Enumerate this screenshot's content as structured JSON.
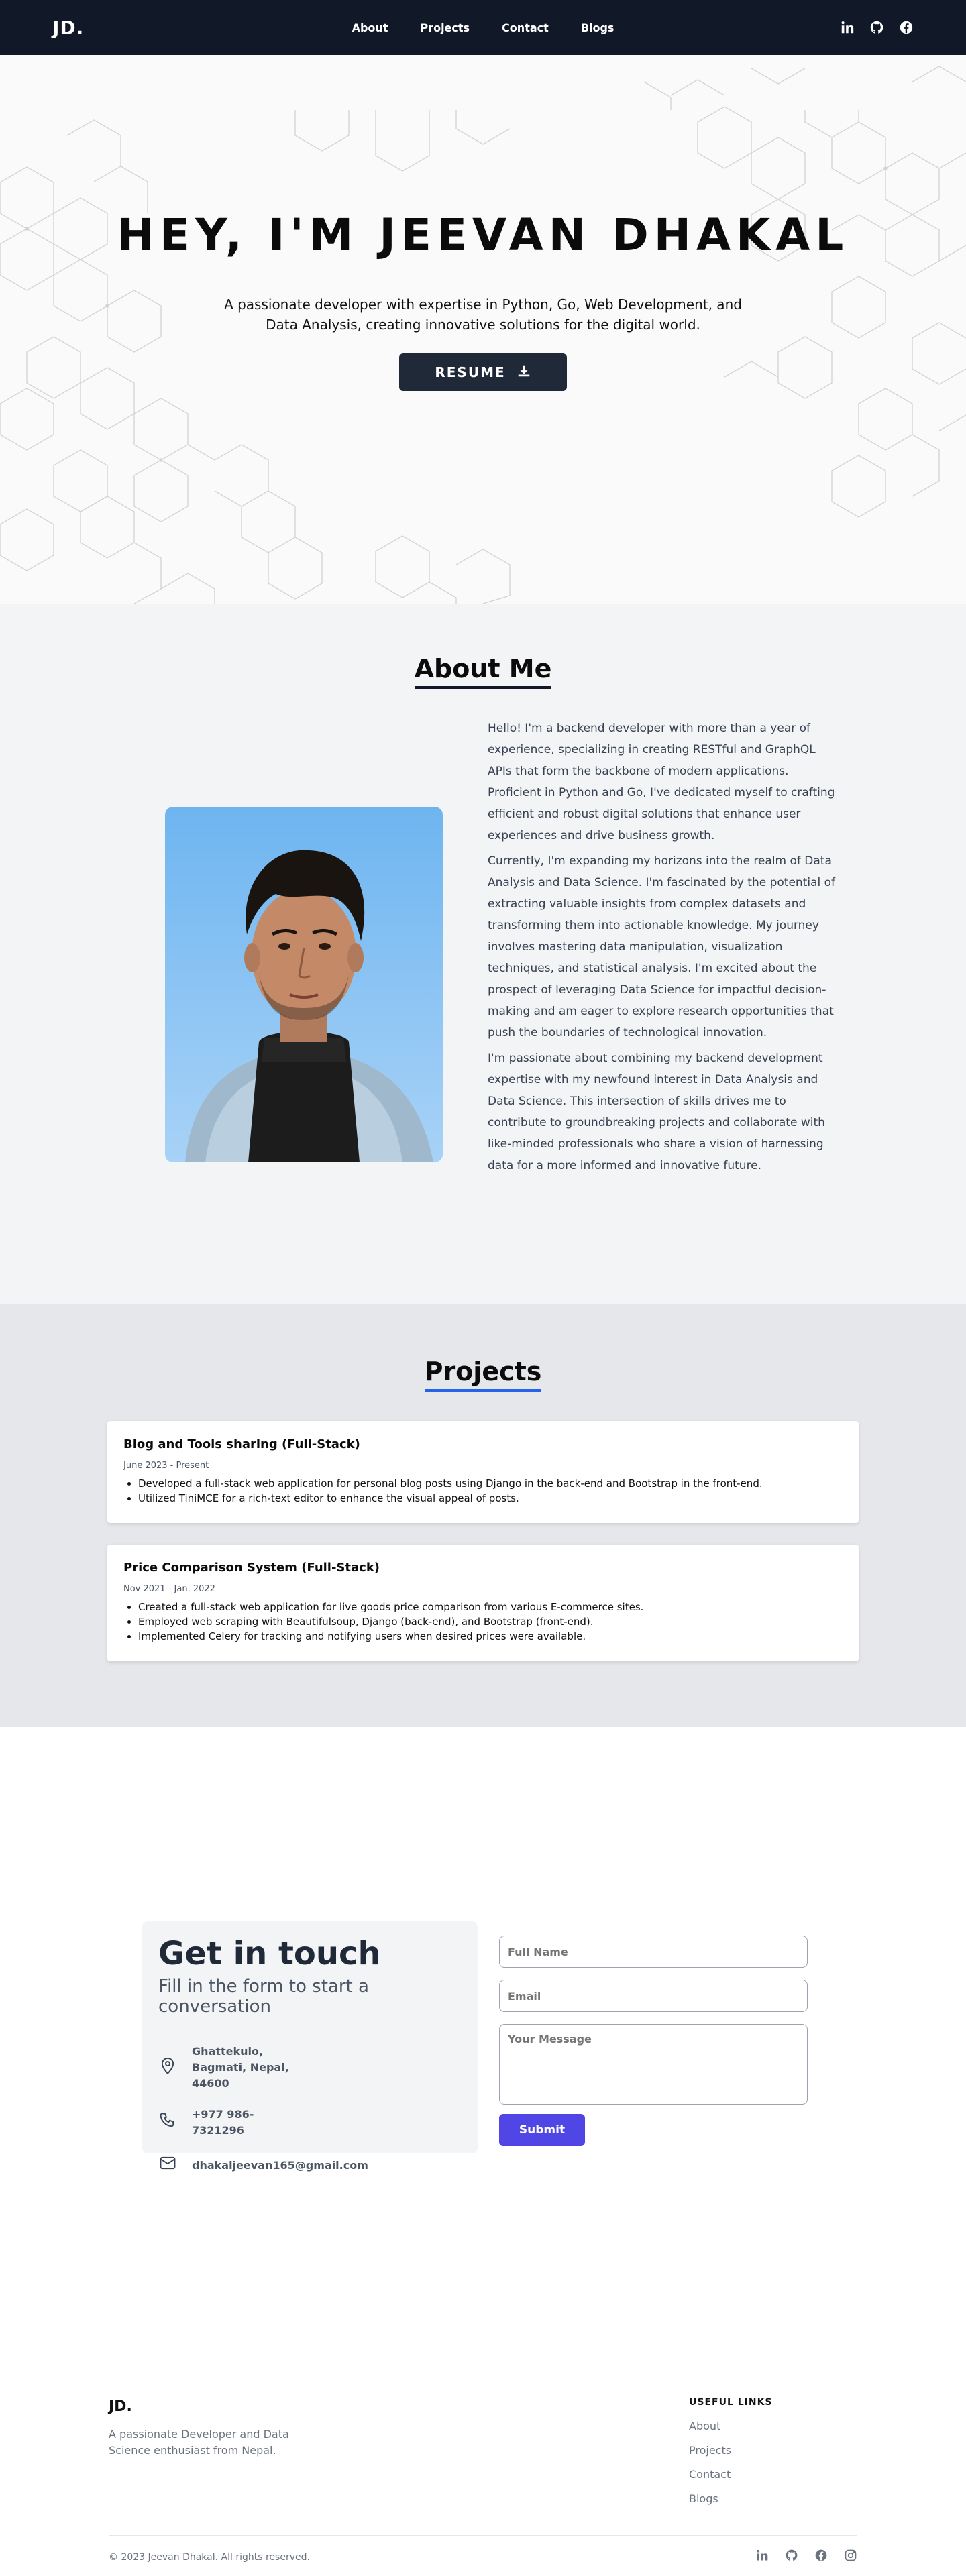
{
  "nav": {
    "logo": "JD.",
    "links": [
      "About",
      "Projects",
      "Contact",
      "Blogs"
    ],
    "icons": [
      "linkedin-icon",
      "github-icon",
      "facebook-icon"
    ]
  },
  "hero": {
    "title": "HEY, I'M JEEVAN DHAKAL",
    "subtitle": "A passionate developer with expertise in Python, Go, Web Development, and Data Analysis, creating innovative solutions for the digital world.",
    "resume_label": "RESUME"
  },
  "about": {
    "title": "About Me",
    "paragraphs": [
      "Hello! I'm a backend developer with more than a year of experience, specializing in creating RESTful and GraphQL APIs that form the backbone of modern applications. Proficient in Python and Go, I've dedicated myself to crafting efficient and robust digital solutions that enhance user experiences and drive business growth.",
      "Currently, I'm expanding my horizons into the realm of Data Analysis and Data Science. I'm fascinated by the potential of extracting valuable insights from complex datasets and transforming them into actionable knowledge. My journey involves mastering data manipulation, visualization techniques, and statistical analysis. I'm excited about the prospect of leveraging Data Science for impactful decision-making and am eager to explore research opportunities that push the boundaries of technological innovation.",
      "I'm passionate about combining my backend development expertise with my newfound interest in Data Analysis and Data Science. This intersection of skills drives me to contribute to groundbreaking projects and collaborate with like-minded professionals who share a vision of harnessing data for a more informed and innovative future."
    ]
  },
  "projects": {
    "title": "Projects",
    "items": [
      {
        "name": "Blog and Tools sharing (Full-Stack)",
        "date": "June 2023 - Present",
        "bullets": [
          "Developed a full-stack web application for personal blog posts using Django in the back-end and Bootstrap in the front-end.",
          "Utilized TiniMCE for a rich-text editor to enhance the visual appeal of posts."
        ]
      },
      {
        "name": "Price Comparison System (Full-Stack)",
        "date": "Nov 2021 - Jan. 2022",
        "bullets": [
          "Created a full-stack web application for live goods price comparison from various E-commerce sites.",
          "Employed web scraping with Beautifulsoup, Django (back-end), and Bootstrap (front-end).",
          "Implemented Celery for tracking and notifying users when desired prices were available."
        ]
      }
    ]
  },
  "contact": {
    "title": "Get in touch",
    "subtitle": "Fill in the form to start a conversation",
    "address": "Ghattekulo, Bagmati, Nepal, 44600",
    "phone": "+977 986-7321296",
    "email": "dhakaljeevan165@gmail.com",
    "form": {
      "name_placeholder": "Full Name",
      "email_placeholder": "Email",
      "message_placeholder": "Your Message",
      "submit_label": "Submit"
    }
  },
  "footer": {
    "logo": "JD.",
    "description": "A passionate Developer and Data Science enthusiast from Nepal.",
    "links_heading": "USEFUL LINKS",
    "links": [
      "About",
      "Projects",
      "Contact",
      "Blogs"
    ],
    "copyright": "© 2023 Jeevan Dhakal. All rights reserved.",
    "icons": [
      "linkedin-icon",
      "github-icon",
      "facebook-icon",
      "instagram-icon"
    ]
  },
  "colors": {
    "nav_bg": "#111827",
    "button_dark": "#1f2937",
    "accent_blue": "#2563eb",
    "submit_indigo": "#4f46e5"
  }
}
